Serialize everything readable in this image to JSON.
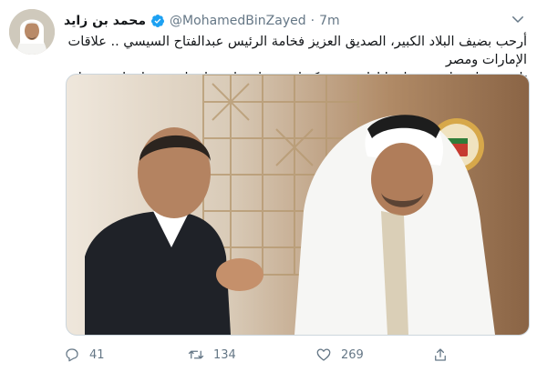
{
  "tweet": {
    "author_name": "محمد بن زايد",
    "handle": "@MohamedBinZayed",
    "separator": "·",
    "time": "7m",
    "text_line1": "أرحب بضيف البلاد الكبير، الصديق العزيز فخامة الرئيس عبدالفتاح السيسي .. علاقات الإمارات ومصر",
    "text_line2": "تاريخية واستراتيجية، ولدينا إرادة مشتركة لتعزيزها وتطويرها بما يخدم بلدينا وشعبينا"
  },
  "actions": {
    "reply_count": "41",
    "retweet_count": "134",
    "like_count": "269"
  },
  "icons": {
    "verified": "verified-badge-icon",
    "caret": "chevron-down-icon",
    "reply": "reply-icon",
    "retweet": "retweet-icon",
    "like": "heart-icon",
    "share": "share-icon"
  },
  "colors": {
    "accent": "#1da1f2",
    "muted": "#657786",
    "text": "#14171a"
  }
}
